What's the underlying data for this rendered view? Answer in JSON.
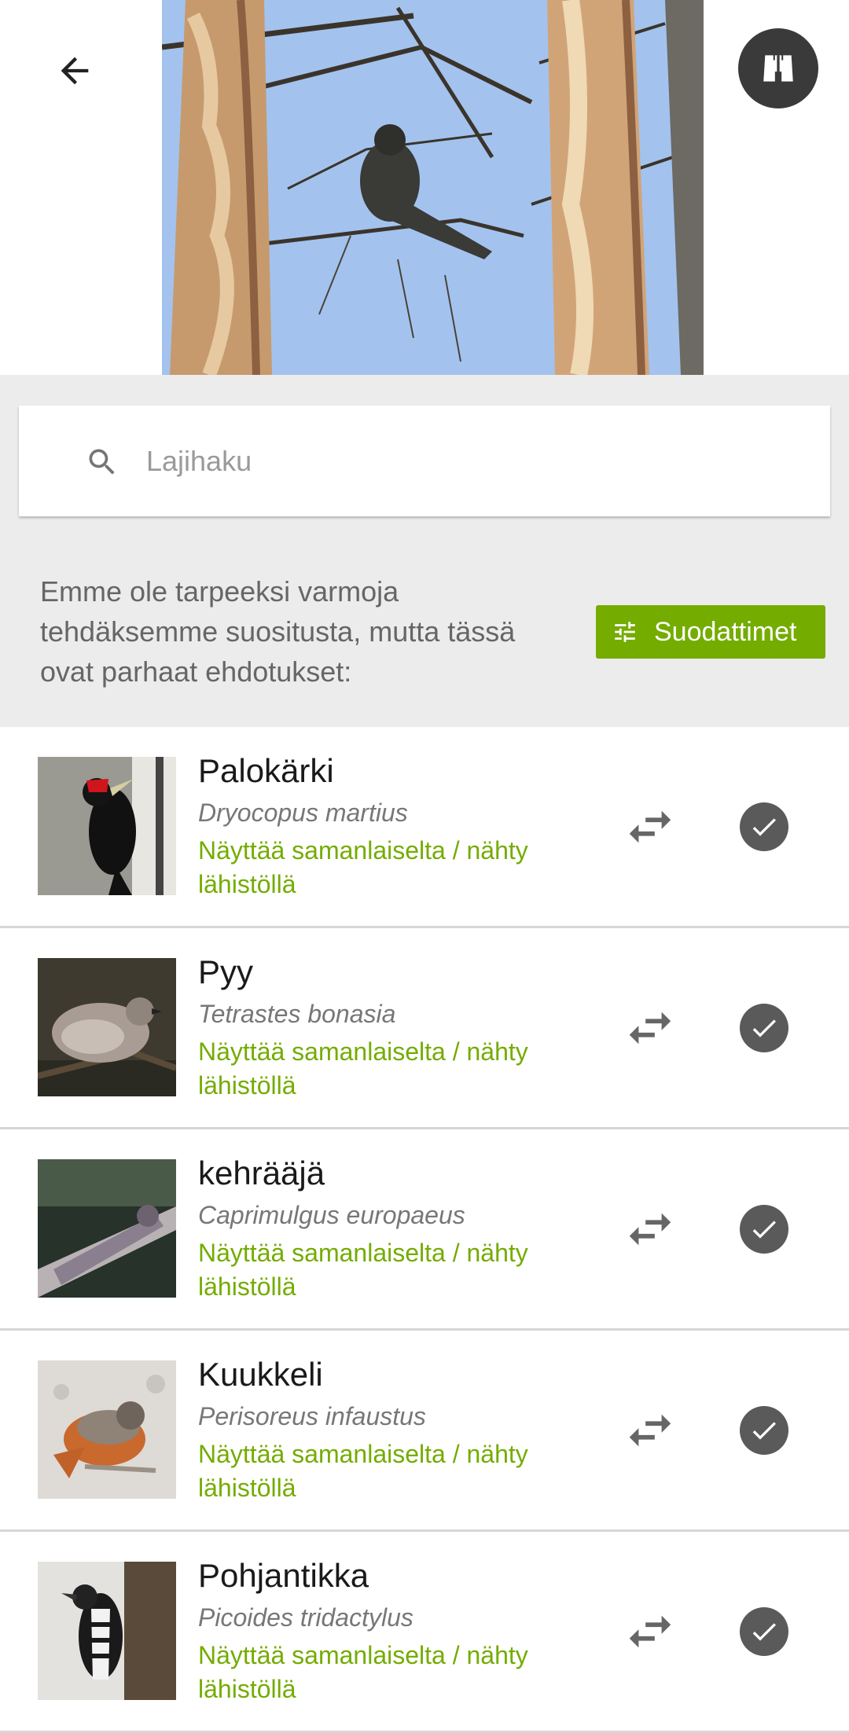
{
  "header": {
    "back_icon": "arrow-left-icon",
    "action_icon": "binoculars-icon"
  },
  "search": {
    "icon": "search-icon",
    "placeholder": "Lajihaku",
    "value": ""
  },
  "notice": {
    "text": "Emme ole tarpeeksi varmoja tehdäksemme suositusta, mutta tässä ovat parhaat ehdotukset:"
  },
  "filters": {
    "icon": "tune-icon",
    "label": "Suodattimet",
    "color": "#74ac00"
  },
  "suggestions": [
    {
      "name": "Palokärki",
      "scientific": "Dryocopus martius",
      "reason": "Näyttää samanlaiselta / nähty lähistöllä"
    },
    {
      "name": "Pyy",
      "scientific": "Tetrastes bonasia",
      "reason": "Näyttää samanlaiselta / nähty lähistöllä"
    },
    {
      "name": "kehrääjä",
      "scientific": "Caprimulgus europaeus",
      "reason": "Näyttää samanlaiselta / nähty lähistöllä"
    },
    {
      "name": "Kuukkeli",
      "scientific": "Perisoreus infaustus",
      "reason": "Näyttää samanlaiselta / nähty lähistöllä"
    },
    {
      "name": "Pohjantikka",
      "scientific": "Picoides tridactylus",
      "reason": "Näyttää samanlaiselta / nähty lähistöllä"
    }
  ],
  "row_icons": {
    "compare": "compare-arrows-icon",
    "select": "check-circle-icon"
  }
}
